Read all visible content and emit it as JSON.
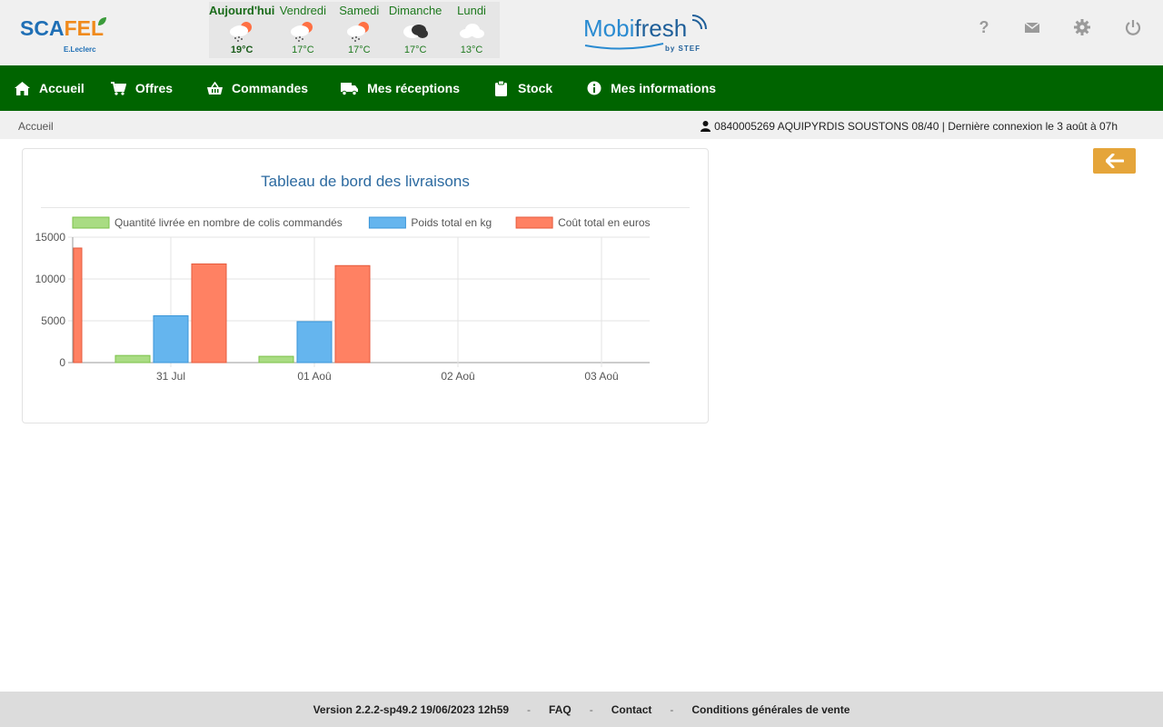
{
  "header": {
    "logo_text_a": "SCA",
    "logo_text_b": "FEL",
    "logo_sub": "E.Leclerc",
    "brand_mobi": "Mobi",
    "brand_fresh": "fresh",
    "brand_by": "by STEF",
    "icons": [
      "help-icon",
      "mail-icon",
      "settings-icon",
      "power-icon"
    ]
  },
  "weather": [
    {
      "day": "Aujourd'hui",
      "temp": "19°C",
      "icon": "snow-sun-icon"
    },
    {
      "day": "Vendredi",
      "temp": "17°C",
      "icon": "snow-sun-icon"
    },
    {
      "day": "Samedi",
      "temp": "17°C",
      "icon": "snow-sun-icon"
    },
    {
      "day": "Dimanche",
      "temp": "17°C",
      "icon": "dark-cloud-icon"
    },
    {
      "day": "Lundi",
      "temp": "13°C",
      "icon": "cloud-icon"
    }
  ],
  "nav": [
    {
      "label": "Accueil",
      "icon": "home-icon"
    },
    {
      "label": "Offres",
      "icon": "cart-icon"
    },
    {
      "label": "Commandes",
      "icon": "basket-icon"
    },
    {
      "label": "Mes réceptions",
      "icon": "truck-icon"
    },
    {
      "label": "Stock",
      "icon": "clipboard-icon"
    },
    {
      "label": "Mes informations",
      "icon": "info-icon"
    }
  ],
  "breadcrumb": "Accueil",
  "user_info": "0840005269 AQUIPYRDIS SOUSTONS 08/40 | Dernière connexion le 3 août à 07h",
  "panel_title": "Tableau de bord des livraisons",
  "chart_data": {
    "type": "bar",
    "categories": [
      "",
      "31 Jul",
      "01 Aoû",
      "02 Aoû",
      "03 Aoû"
    ],
    "series": [
      {
        "name": "Quantité livrée en nombre de colis commandés",
        "color": "#a9dc83",
        "border": "#7cc24a",
        "values": [
          null,
          850,
          750,
          null,
          null
        ]
      },
      {
        "name": "Poids total en kg",
        "color": "#65b5ee",
        "border": "#3a95d8",
        "values": [
          null,
          5600,
          4900,
          null,
          null
        ]
      },
      {
        "name": "Coût total en euros",
        "color": "#ff8163",
        "border": "#e55a3c",
        "values": [
          13700,
          11800,
          11600,
          null,
          null
        ]
      }
    ],
    "ylim": [
      0,
      15000
    ],
    "yticks": [
      0,
      5000,
      10000,
      15000
    ],
    "legend_position": "top"
  },
  "footer": {
    "version": "Version 2.2.2-sp49.2 19/06/2023 12h59",
    "faq": "FAQ",
    "contact": "Contact",
    "cgv": "Conditions générales de vente",
    "sep": "-"
  }
}
